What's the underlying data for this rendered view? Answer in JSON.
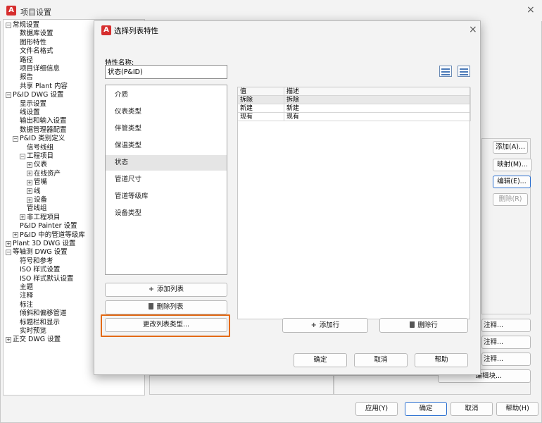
{
  "main_window": {
    "title": "项目设置",
    "close_glyph": "×",
    "tree": [
      {
        "label": "常规设置",
        "indent": 0,
        "expander": "−"
      },
      {
        "label": "数据库设置",
        "indent": 1
      },
      {
        "label": "图形特性",
        "indent": 1
      },
      {
        "label": "文件名格式",
        "indent": 1
      },
      {
        "label": "路径",
        "indent": 1
      },
      {
        "label": "项目详细信息",
        "indent": 1
      },
      {
        "label": "报告",
        "indent": 1
      },
      {
        "label": "共享 Plant 内容",
        "indent": 1
      },
      {
        "label": "P&ID DWG 设置",
        "indent": 0,
        "expander": "−"
      },
      {
        "label": "显示设置",
        "indent": 1
      },
      {
        "label": "线设置",
        "indent": 1
      },
      {
        "label": "输出和输入设置",
        "indent": 1
      },
      {
        "label": "数据管理器配置",
        "indent": 1
      },
      {
        "label": "P&ID 类别定义",
        "indent": 1,
        "expander": "−"
      },
      {
        "label": "信号线组",
        "indent": 2
      },
      {
        "label": "工程项目",
        "indent": 2,
        "expander": "−"
      },
      {
        "label": "仪表",
        "indent": 3,
        "expander": "+"
      },
      {
        "label": "在线资产",
        "indent": 3,
        "expander": "+"
      },
      {
        "label": "管嘴",
        "indent": 3,
        "expander": "+"
      },
      {
        "label": "线",
        "indent": 3,
        "expander": "+"
      },
      {
        "label": "设备",
        "indent": 3,
        "expander": "+"
      },
      {
        "label": "管线组",
        "indent": 2
      },
      {
        "label": "非工程项目",
        "indent": 2,
        "expander": "+"
      },
      {
        "label": "P&ID Painter 设置",
        "indent": 1
      },
      {
        "label": "P&ID 中的管道等级库",
        "indent": 1,
        "expander": "+"
      },
      {
        "label": "Plant 3D DWG 设置",
        "indent": 0,
        "expander": "+"
      },
      {
        "label": "等轴测 DWG 设置",
        "indent": 0,
        "expander": "−"
      },
      {
        "label": "符号和参考",
        "indent": 1
      },
      {
        "label": "ISO 样式设置",
        "indent": 1
      },
      {
        "label": "ISO 样式默认设置",
        "indent": 1
      },
      {
        "label": "主题",
        "indent": 1
      },
      {
        "label": "注释",
        "indent": 1
      },
      {
        "label": "标注",
        "indent": 1
      },
      {
        "label": "倾斜和偏移管道",
        "indent": 1
      },
      {
        "label": "标题栏和显示",
        "indent": 1
      },
      {
        "label": "实时预览",
        "indent": 1
      },
      {
        "label": "正交 DWG 设置",
        "indent": 0,
        "expander": "+"
      }
    ],
    "right_buttons": {
      "add": "添加(A)...",
      "map": "映射(M)...",
      "edit": "编辑(E)...",
      "delete": "删除(R)"
    },
    "annot_buttons": {
      "a": "注释...",
      "b": "注释...",
      "c": "注释...",
      "block": "编辑块..."
    },
    "bottom_buttons": {
      "apply": "应用(Y)",
      "ok": "确定",
      "cancel": "取消",
      "help": "帮助(H)"
    }
  },
  "dialog": {
    "title": "选择列表特性",
    "close_glyph": "×",
    "property_name_label": "特性名称:",
    "property_name_value": "状态(P&ID)",
    "lists": [
      "介质",
      "仪表类型",
      "伴管类型",
      "保温类型",
      "状态",
      "管道尺寸",
      "管道等级库",
      "设备类型"
    ],
    "selected_index": 4,
    "add_list": "添加列表",
    "delete_list": "删除列表",
    "change_list_type": "更改列表类型...",
    "table": {
      "headers": [
        "值",
        "描述"
      ],
      "rows": [
        [
          "拆除",
          "拆除"
        ],
        [
          "新建",
          "新建"
        ],
        [
          "现有",
          "现有"
        ]
      ]
    },
    "add_row": "添加行",
    "delete_row": "删除行",
    "ok": "确定",
    "cancel": "取消",
    "help": "帮助",
    "icons": {
      "plus": "+",
      "app_icon": "A"
    }
  }
}
